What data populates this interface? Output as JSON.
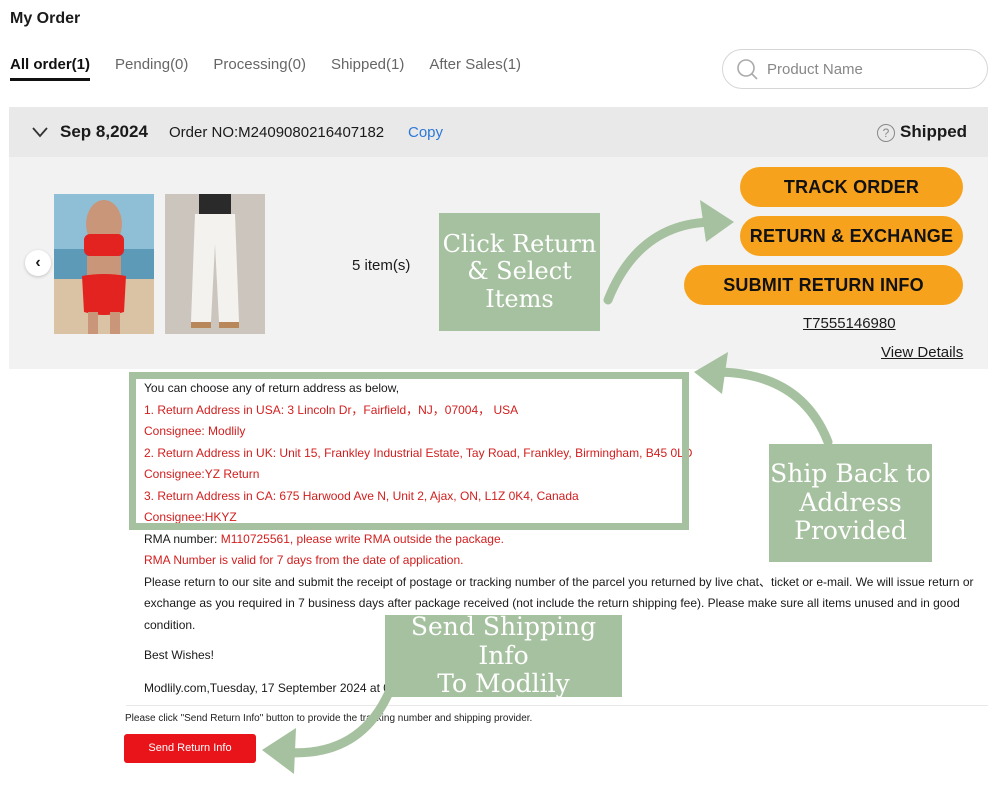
{
  "page": {
    "title": "My Order"
  },
  "tabs": [
    {
      "label": "All order(1)",
      "active": true
    },
    {
      "label": "Pending(0)",
      "active": false
    },
    {
      "label": "Processing(0)",
      "active": false
    },
    {
      "label": "Shipped(1)",
      "active": false
    },
    {
      "label": "After Sales(1)",
      "active": false
    }
  ],
  "search": {
    "placeholder": "Product Name",
    "icon": "search-icon"
  },
  "order": {
    "date": "Sep 8,2024",
    "number": "Order NO:M2409080216407182",
    "copy_label": "Copy",
    "status": "Shipped",
    "status_icon": "help-icon",
    "items_count": "5 item(s)",
    "buttons": {
      "track": "TRACK ORDER",
      "return_exchange": "RETURN & EXCHANGE",
      "submit_return": "SUBMIT RETURN INFO"
    },
    "button_color": "#f7a21c",
    "tracking_number": "T7555146980",
    "view_details": "View Details"
  },
  "message": {
    "intro": "You can choose any of return address as below,",
    "addresses": [
      "1. Return Address in USA: 3 Lincoln Dr，Fairfield，NJ，07004， USA",
      "Consignee: Modlily",
      "2. Return Address in UK: Unit 15, Frankley Industrial Estate, Tay Road, Frankley, Birmingham, B45 0LD",
      "Consignee:YZ Return",
      "3. Return Address in CA: 675 Harwood Ave N, Unit 2, Ajax, ON, L1Z 0K4, Canada",
      "Consignee:HKYZ"
    ],
    "rma_label": "RMA number:",
    "rma_value": "M110725561, please write RMA outside the package.",
    "rma_valid": "RMA Number is valid for 7 days from the date of application.",
    "body": "Please return to our site and submit the receipt of postage or tracking number of the parcel you returned by live chat、ticket or e-mail. We will issue return or exchange as you required in 7 business days after package received (not include the return shipping fee). Please make sure all items unused and in good condition.",
    "closing": "Best Wishes!",
    "signature": "Modlily.com,Tuesday, 17 September 2024 at 0"
  },
  "below_note": "Please click \"Send Return Info\" button to provide the tracking number and shipping provider.",
  "send_button": "Send Return Info",
  "annotations": [
    "Click Return\n& Select\nItems",
    "Ship Back to\nAddress\nProvided",
    "Send Shipping Info\nTo Modlily"
  ],
  "colors": {
    "accent": "#f7a21c",
    "annotation": "#a6c19f",
    "red_text": "#d21e1e",
    "send_button": "#e8141a",
    "link": "#2c78d8"
  }
}
